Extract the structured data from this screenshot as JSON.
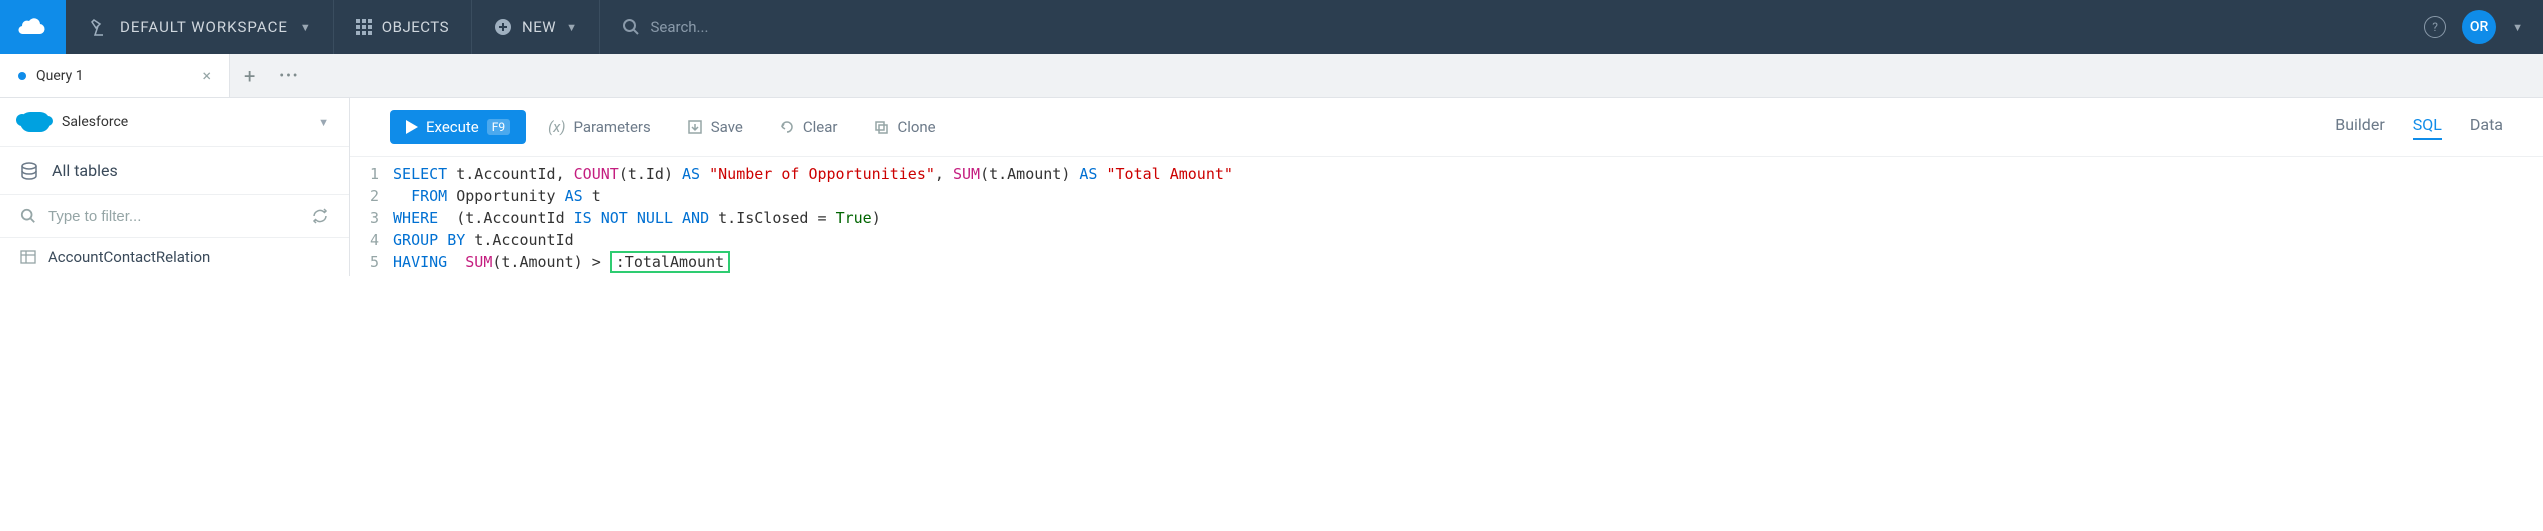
{
  "topbar": {
    "workspace_label": "DEFAULT WORKSPACE",
    "objects_label": "OBJECTS",
    "new_label": "NEW",
    "search_placeholder": "Search...",
    "avatar_initials": "OR"
  },
  "tabs": {
    "items": [
      {
        "label": "Query 1",
        "dirty": true
      }
    ]
  },
  "sidebar": {
    "connection_label": "Salesforce",
    "all_tables_label": "All tables",
    "filter_placeholder": "Type to filter...",
    "tables": [
      {
        "label": "AccountContactRelation"
      }
    ]
  },
  "toolbar": {
    "execute_label": "Execute",
    "execute_key": "F9",
    "parameters_label": "Parameters",
    "save_label": "Save",
    "clear_label": "Clear",
    "clone_label": "Clone",
    "modes": {
      "builder": "Builder",
      "sql": "SQL",
      "data": "Data"
    },
    "active_mode": "sql"
  },
  "editor": {
    "lines": [
      "1",
      "2",
      "3",
      "4",
      "5"
    ],
    "sql": {
      "l1": {
        "select": "SELECT",
        "col1": " t.AccountId, ",
        "count": "COUNT",
        "count_args": "(t.Id) ",
        "as1": "AS",
        "str1": " \"Number of Opportunities\"",
        "comma": ", ",
        "sum": "SUM",
        "sum_args": "(t.Amount) ",
        "as2": "AS",
        "str2": " \"Total Amount\""
      },
      "l2": {
        "from": "FROM",
        "rest": " Opportunity ",
        "as": "AS",
        "alias": " t"
      },
      "l3": {
        "where": "WHERE",
        "open": "  (t.AccountId ",
        "is": "IS",
        "sp1": " ",
        "not": "NOT",
        "sp2": " ",
        "null": "NULL",
        "sp3": " ",
        "and": "AND",
        "rest": " t.IsClosed = ",
        "true": "True",
        "close": ")"
      },
      "l4": {
        "group": "GROUP",
        "sp": " ",
        "by": "BY",
        "rest": " t.AccountId"
      },
      "l5": {
        "having": "HAVING",
        "sp": "  ",
        "sum": "SUM",
        "args": "(t.Amount) > ",
        "param": ":TotalAmount"
      }
    }
  }
}
